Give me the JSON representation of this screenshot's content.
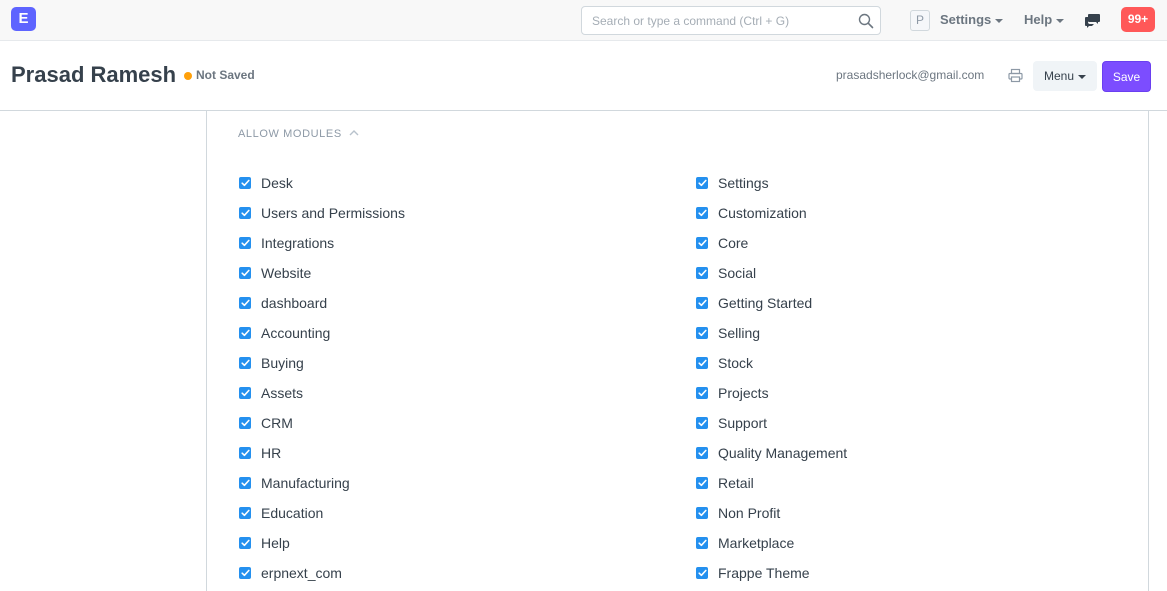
{
  "navbar": {
    "logo_letter": "E",
    "search_placeholder": "Search or type a command (Ctrl + G)",
    "avatar_letter": "P",
    "settings_label": "Settings",
    "help_label": "Help",
    "notification_count": "99+"
  },
  "page": {
    "title": "Prasad Ramesh",
    "status": "Not Saved",
    "email": "prasadsherlock@gmail.com",
    "menu_label": "Menu",
    "save_label": "Save"
  },
  "section": {
    "title": "ALLOW MODULES",
    "left_modules": [
      "Desk",
      "Users and Permissions",
      "Integrations",
      "Website",
      "dashboard",
      "Accounting",
      "Buying",
      "Assets",
      "CRM",
      "HR",
      "Manufacturing",
      "Education",
      "Help",
      "erpnext_com"
    ],
    "right_modules": [
      "Settings",
      "Customization",
      "Core",
      "Social",
      "Getting Started",
      "Selling",
      "Stock",
      "Projects",
      "Support",
      "Quality Management",
      "Retail",
      "Non Profit",
      "Marketplace",
      "Frappe Theme"
    ]
  },
  "colors": {
    "accent": "#7c4dff",
    "checkbox": "#2490ef",
    "badge": "#ff5858",
    "status_dot": "#ffa00a"
  }
}
